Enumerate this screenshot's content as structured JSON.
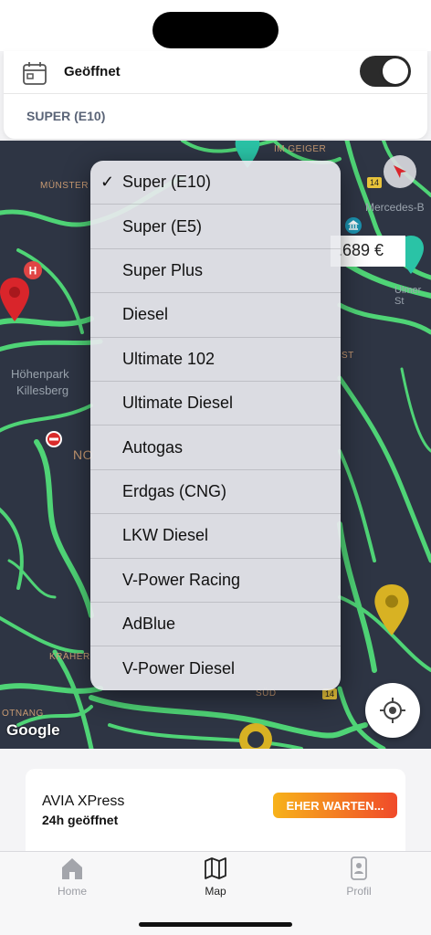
{
  "filter": {
    "open_label": "Geöffnet",
    "open_toggle": "on",
    "selected_fuel": "SUPER (E10)"
  },
  "map": {
    "labels": {
      "muenster": "MÜNSTER",
      "im_geiger": "IM GEIGER",
      "hoehenpark": "Höhenpark",
      "killesberg": "Killesberg",
      "mercedes": "Mercedes-B",
      "ulmer": "Ulmer St",
      "st": "ST",
      "kraeher": "KRÄHER",
      "otnang": "OTNANG",
      "sued": "SÜD",
      "no": "NO",
      "route_14a": "14",
      "route_14b": "14",
      "sued_short": "SÜD"
    },
    "price_tag": ".689 €",
    "attribution": "Google"
  },
  "fuel_menu": {
    "checked_index": 0,
    "items": [
      "Super (E10)",
      "Super (E5)",
      "Super Plus",
      "Diesel",
      "Ultimate 102",
      "Ultimate Diesel",
      "Autogas",
      "Erdgas (CNG)",
      "LKW Diesel",
      "V-Power Racing",
      "AdBlue",
      "V-Power Diesel"
    ]
  },
  "station": {
    "name": "AVIA XPress",
    "hours": "24h geöffnet",
    "wait_button": "EHER WARTEN..."
  },
  "tabs": {
    "home": "Home",
    "map": "Map",
    "profile": "Profil",
    "active": "map"
  },
  "colors": {
    "road_green": "#4fd476",
    "map_bg": "#2e3544",
    "wait_gradient_start": "#f7b21a",
    "wait_gradient_end": "#f04a2a",
    "pin_red": "#d9252b",
    "pin_yellow": "#d8b223",
    "pin_teal": "#2ac3a6"
  }
}
